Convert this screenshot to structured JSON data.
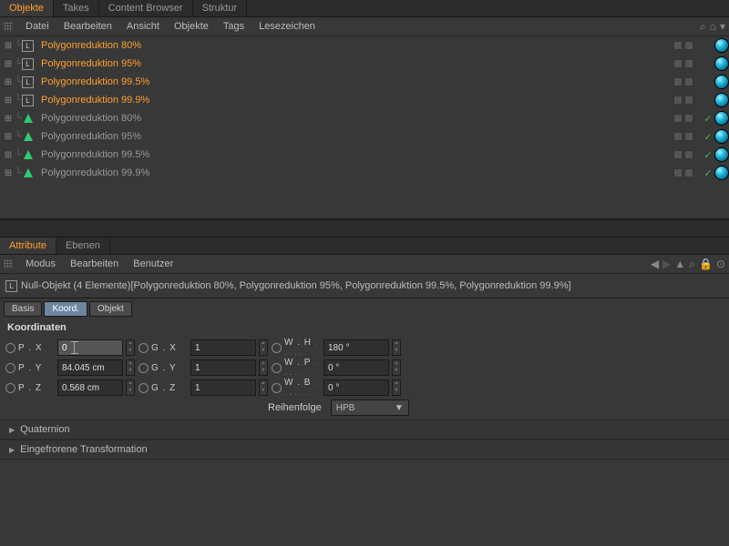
{
  "topTabs": [
    "Objekte",
    "Takes",
    "Content Browser",
    "Struktur"
  ],
  "topMenu": [
    "Datei",
    "Bearbeiten",
    "Ansicht",
    "Objekte",
    "Tags",
    "Lesezeichen"
  ],
  "objects": [
    {
      "icon": "null",
      "name": "Polygonreduktion 80%",
      "sel": true,
      "check": false
    },
    {
      "icon": "null",
      "name": "Polygonreduktion 95%",
      "sel": true,
      "check": false
    },
    {
      "icon": "null",
      "name": "Polygonreduktion 99.5%",
      "sel": true,
      "check": false
    },
    {
      "icon": "null",
      "name": "Polygonreduktion 99.9%",
      "sel": true,
      "check": false
    },
    {
      "icon": "tri",
      "name": "Polygonreduktion 80%",
      "sel": false,
      "check": true
    },
    {
      "icon": "tri",
      "name": "Polygonreduktion 95%",
      "sel": false,
      "check": true
    },
    {
      "icon": "tri",
      "name": "Polygonreduktion 99.5%",
      "sel": false,
      "check": true
    },
    {
      "icon": "tri",
      "name": "Polygonreduktion 99.9%",
      "sel": false,
      "check": true
    }
  ],
  "attrTabs": [
    "Attribute",
    "Ebenen"
  ],
  "attrMenu": [
    "Modus",
    "Bearbeiten",
    "Benutzer"
  ],
  "titlePrefix": "Null-Objekt (4 Elemente)",
  "titleList": " [Polygonreduktion 80%, Polygonreduktion 95%, Polygonreduktion 99.5%, Polygonreduktion 99.9%]",
  "miniTabs": [
    "Basis",
    "Koord.",
    "Objekt"
  ],
  "sectionTitle": "Koordinaten",
  "coords": {
    "PX": {
      "label": "P . X",
      "value": "0",
      "editing": true
    },
    "PY": {
      "label": "P . Y",
      "value": "84.045 cm"
    },
    "PZ": {
      "label": "P . Z",
      "value": "0.568 cm"
    },
    "GX": {
      "label": "G . X",
      "value": "1"
    },
    "GY": {
      "label": "G . Y",
      "value": "1"
    },
    "GZ": {
      "label": "G . Z",
      "value": "1"
    },
    "WH": {
      "label": "W . H",
      "value": "180 °",
      "dots": true
    },
    "WP": {
      "label": "W . P",
      "value": "0 °",
      "dots": true
    },
    "WB": {
      "label": "W . B",
      "value": "0 °",
      "dots": true
    }
  },
  "orderLabel": "Reihenfolge",
  "orderValue": "HPB",
  "accordion": [
    "Quaternion",
    "Eingefrorene Transformation"
  ]
}
